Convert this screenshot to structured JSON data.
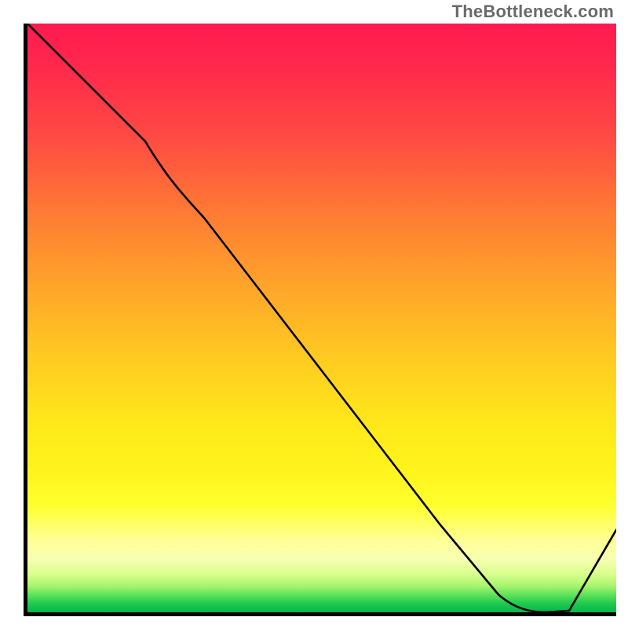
{
  "watermark": "TheBottleneck.com",
  "colors": {
    "curve": "#000000",
    "frame": "#000000",
    "watermark": "#6a6a6a",
    "label": "#d84a3a",
    "gradient_top": "#ff1a50",
    "gradient_bottom": "#00b84a"
  },
  "overlay_label": "",
  "chart_data": {
    "type": "line",
    "title": "",
    "xlabel": "",
    "ylabel": "",
    "xlim": [
      0,
      100
    ],
    "ylim": [
      0,
      100
    ],
    "grid": false,
    "legend": false,
    "series": [
      {
        "name": "curve",
        "x": [
          0,
          10,
          20,
          30,
          40,
          50,
          60,
          70,
          80,
          88,
          100
        ],
        "y": [
          100,
          90,
          80,
          67,
          54,
          41,
          28,
          15,
          3,
          0,
          14
        ]
      }
    ],
    "notes": "Background is a vertical red→green gradient; curve is a single black line dipping to a minimum near x≈82–88 then rising."
  }
}
